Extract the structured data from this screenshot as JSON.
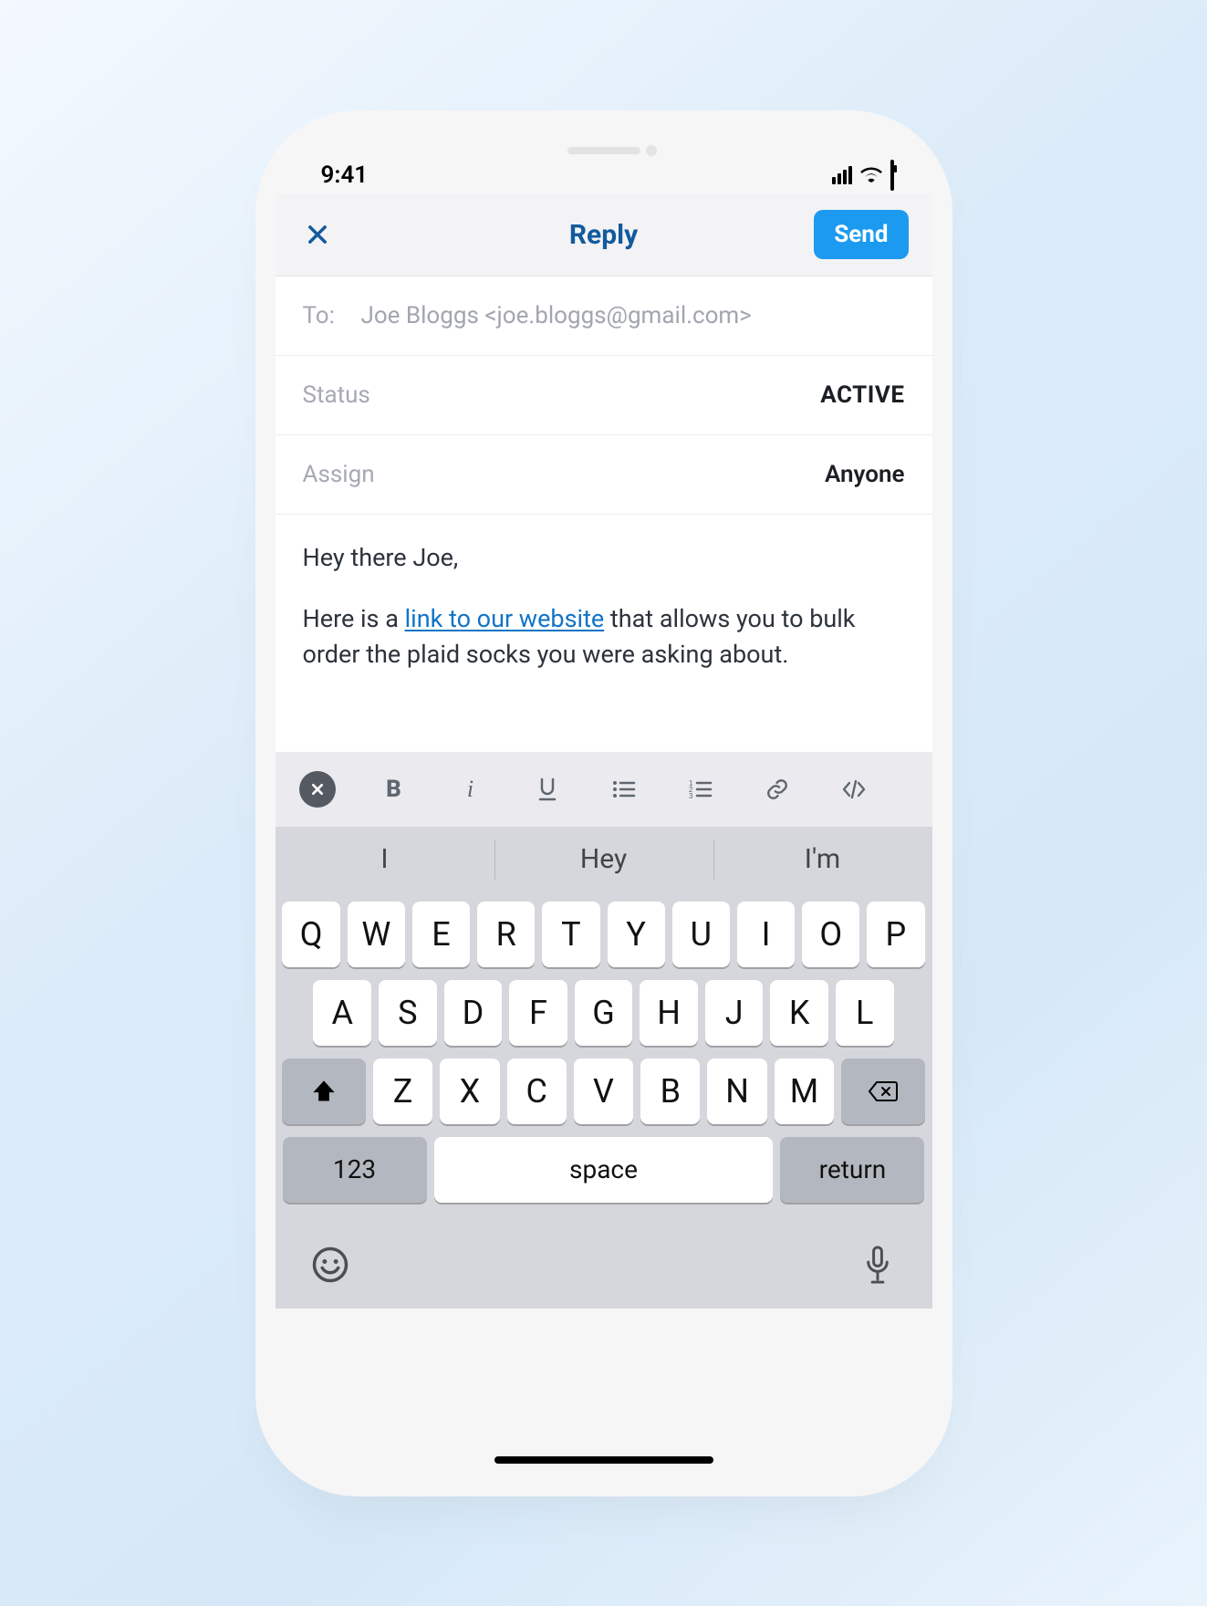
{
  "status_bar": {
    "time": "9:41"
  },
  "nav": {
    "title": "Reply",
    "send_label": "Send"
  },
  "fields": {
    "to_label": "To:",
    "to_value": "Joe Bloggs <joe.bloggs@gmail.com>",
    "status_label": "Status",
    "status_value": "ACTIVE",
    "assign_label": "Assign",
    "assign_value": "Anyone"
  },
  "body": {
    "line1": "Hey there Joe,",
    "line2_pre": "Here is a ",
    "line2_link": "link to our website",
    "line2_post": " that allows you to bulk order the plaid socks you were asking about."
  },
  "suggestions": {
    "s1": "I",
    "s2": "Hey",
    "s3": "I'm"
  },
  "keyboard": {
    "row1": [
      "Q",
      "W",
      "E",
      "R",
      "T",
      "Y",
      "U",
      "I",
      "O",
      "P"
    ],
    "row2": [
      "A",
      "S",
      "D",
      "F",
      "G",
      "H",
      "J",
      "K",
      "L"
    ],
    "row3": [
      "Z",
      "X",
      "C",
      "V",
      "B",
      "N",
      "M"
    ],
    "num_label": "123",
    "space_label": "space",
    "return_label": "return"
  }
}
